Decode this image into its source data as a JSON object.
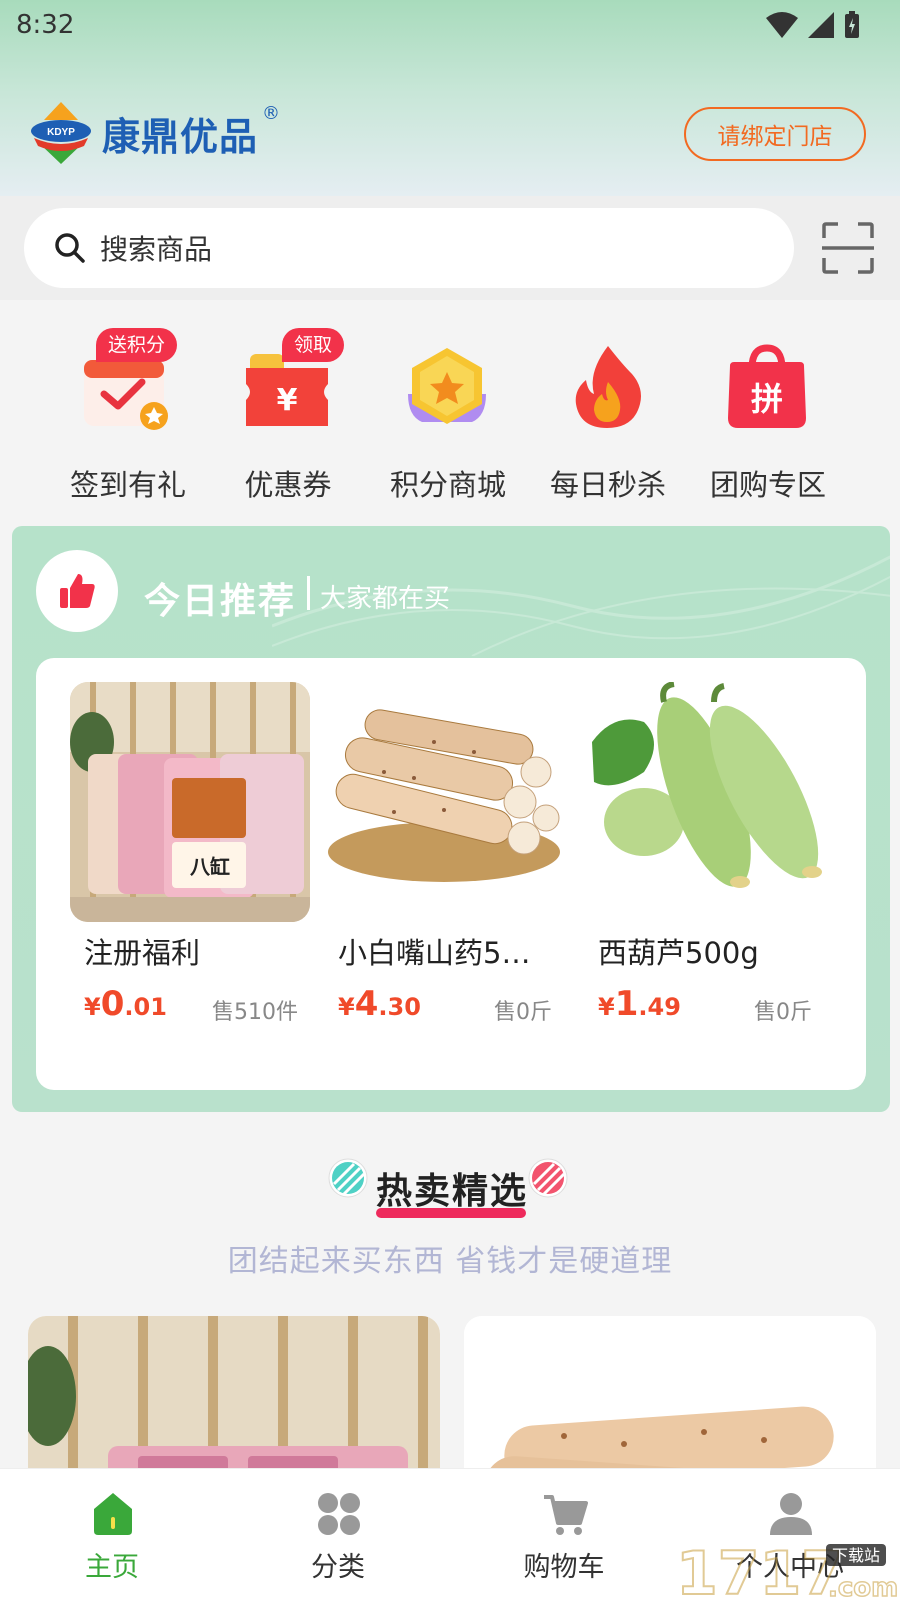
{
  "status_bar": {
    "time": "8:32"
  },
  "header": {
    "brand_abbr": "KDYP",
    "brand_name": "康鼎优品",
    "brand_reg": "®",
    "bind_store_label": "请绑定门店"
  },
  "search": {
    "placeholder": "搜索商品"
  },
  "quick_nav": [
    {
      "label": "签到有礼",
      "badge": "送积分",
      "icon": "calendar-check-icon"
    },
    {
      "label": "优惠券",
      "badge": "领取",
      "icon": "coupon-icon"
    },
    {
      "label": "积分商城",
      "badge": "",
      "icon": "star-hexagon-icon"
    },
    {
      "label": "每日秒杀",
      "badge": "",
      "icon": "flame-icon"
    },
    {
      "label": "团购专区",
      "badge": "",
      "icon": "group-buy-bag-icon"
    }
  ],
  "recommend": {
    "title": "今日推荐",
    "subtitle": "大家都在买",
    "products": [
      {
        "name": "注册福利",
        "currency": "¥",
        "price_int": "0",
        "price_dec": ".01",
        "sold": "售510件"
      },
      {
        "name": "小白嘴山药5…",
        "currency": "¥",
        "price_int": "4",
        "price_dec": ".30",
        "sold": "售0斤"
      },
      {
        "name": "西葫芦500g",
        "currency": "¥",
        "price_int": "1",
        "price_dec": ".49",
        "sold": "售0斤"
      }
    ]
  },
  "hot": {
    "title": "热卖精选",
    "subtitle": "团结起来买东西 省钱才是硬道理"
  },
  "tabs": [
    {
      "label": "主页",
      "active": true
    },
    {
      "label": "分类",
      "active": false
    },
    {
      "label": "购物车",
      "active": false
    },
    {
      "label": "个人中心",
      "active": false
    }
  ],
  "watermark": {
    "text": "1717",
    "accent": "下载站",
    "suffix": ".com"
  },
  "colors": {
    "accent_orange": "#f26a21",
    "price_red": "#f04a2a",
    "tab_active": "#3aa83a",
    "badge_red": "#f2324a"
  }
}
